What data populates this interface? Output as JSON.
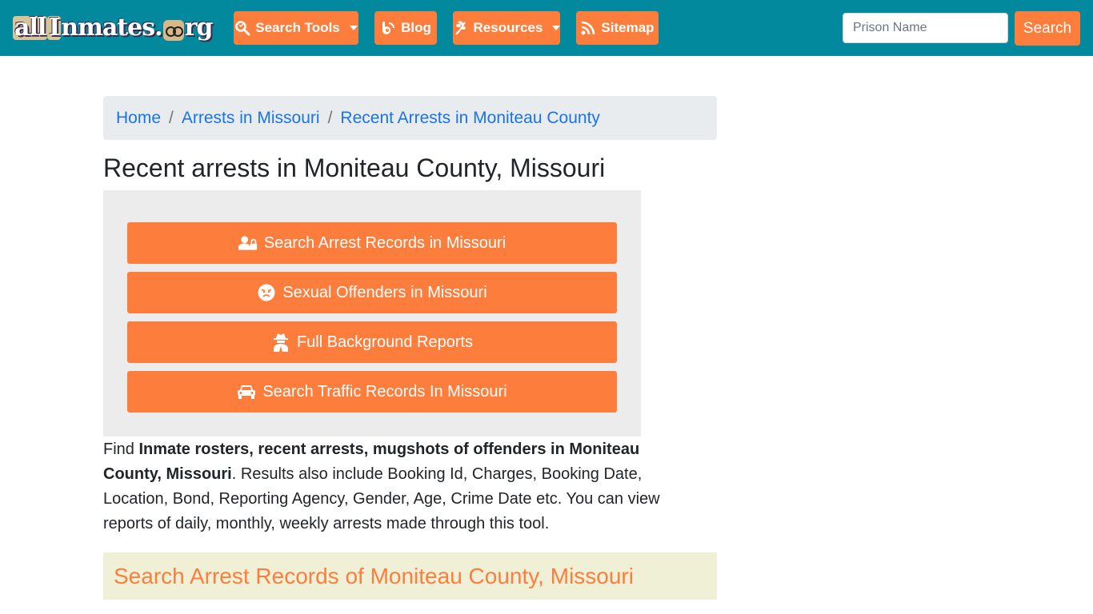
{
  "navbar": {
    "logo": {
      "part1": "all",
      "part2": "I",
      "part3": "nmates.",
      "part4": "rg"
    },
    "items": [
      {
        "label": "Search Tools",
        "icon": "search-icon",
        "dropdown": true
      },
      {
        "label": "Blog",
        "icon": "blogger-icon",
        "dropdown": false
      },
      {
        "label": "Resources",
        "icon": "leaf-icon",
        "dropdown": true
      },
      {
        "label": "Sitemap",
        "icon": "rss-icon",
        "dropdown": false
      }
    ],
    "search": {
      "placeholder": "Prison Name",
      "value": "",
      "button_label": "Search"
    }
  },
  "breadcrumb": {
    "items": [
      "Home",
      "Arrests in Missouri",
      "Recent Arrests in Moniteau County"
    ],
    "separator": "/"
  },
  "page_title": "Recent arrests in Moniteau County, Missouri",
  "actions": [
    {
      "label": "Search Arrest Records in Missouri",
      "icon": "user-lock-icon"
    },
    {
      "label": "Sexual Offenders in Missouri",
      "icon": "angry-face-icon"
    },
    {
      "label": "Full Background Reports",
      "icon": "user-secret-icon"
    },
    {
      "label": "Search Traffic Records In Missouri",
      "icon": "car-icon"
    }
  ],
  "intro": {
    "prefix": "Find ",
    "bold": "Inmate rosters, recent arrests, mugshots of offenders in Moniteau County, Missouri",
    "suffix": ". Results also include Booking Id, Charges, Booking Date, Location, Bond, Reporting Agency, Gender, Age, Crime Date etc. You can view reports of daily, monthly, weekly arrests made through this tool."
  },
  "section_heading": "Search Arrest Records of Moniteau County, Missouri",
  "colors": {
    "navbar": "#02899e",
    "accent": "#fd7e3c",
    "link": "#1a73e8",
    "section_bg": "#f0f0d6"
  }
}
